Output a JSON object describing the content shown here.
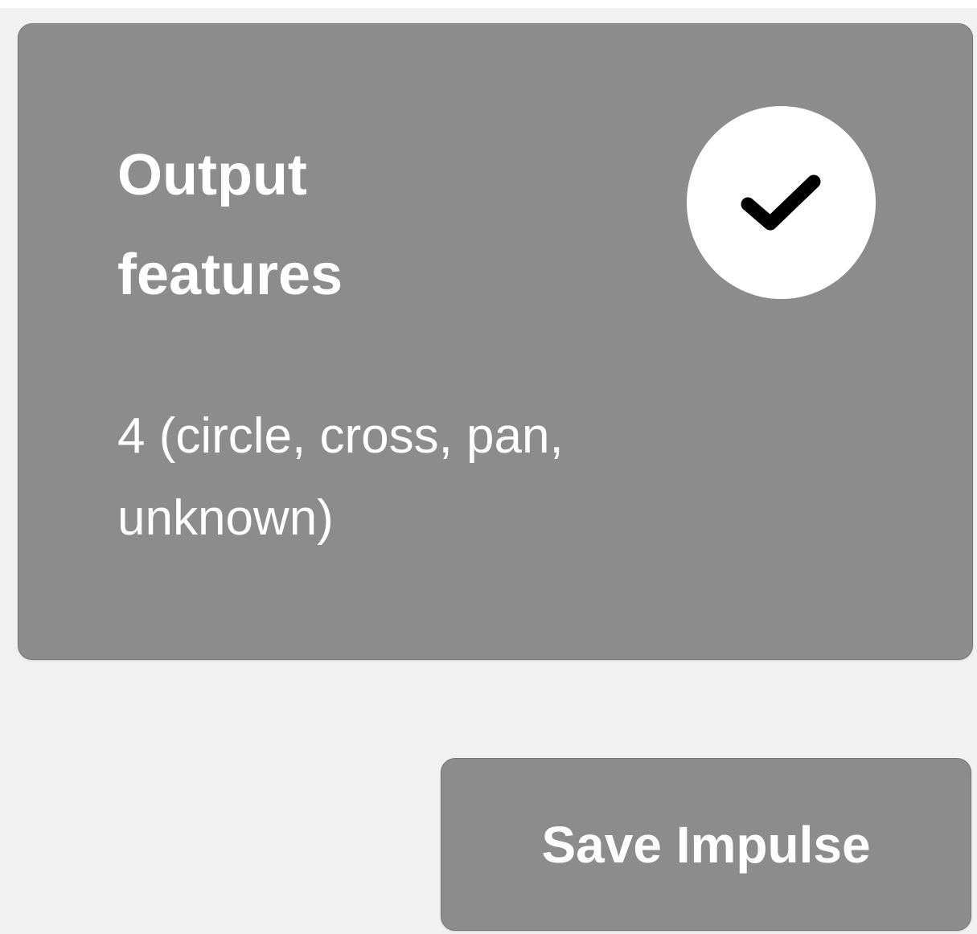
{
  "card": {
    "title": "Output\nfeatures",
    "value": "4 (circle, cross, pan,\nunknown)",
    "status_icon": "checkmark-icon"
  },
  "actions": {
    "save_label": "Save Impulse"
  },
  "colors": {
    "background": "#f1f1f1",
    "card": "#8c8c8c",
    "text": "#ffffff",
    "icon_circle": "#ffffff",
    "icon": "#000000"
  }
}
